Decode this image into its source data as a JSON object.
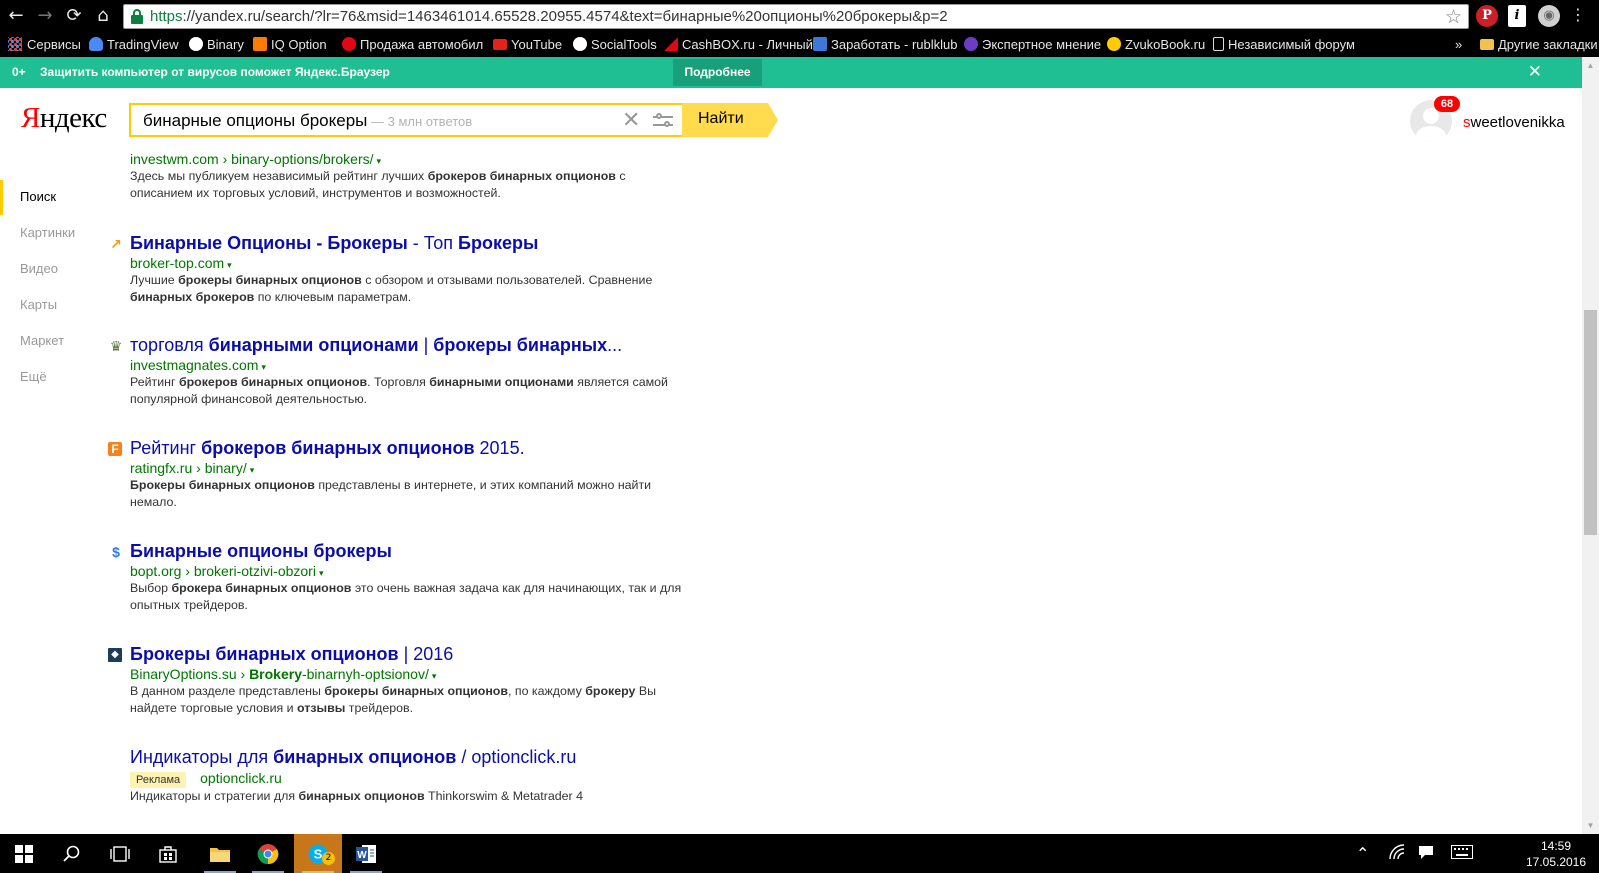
{
  "browser": {
    "url_scheme": "https",
    "url_rest": "://yandex.ru/search/?lr=76&msid=1463461014.65528.20955.4574&text=бинарные%20опционы%20брокеры&p=2",
    "nav": {
      "back": "←",
      "forward": "→",
      "reload": "⟳",
      "home": "⌂"
    },
    "bookmark_star": "☆",
    "extensions": {
      "pinterest": "P",
      "info": "i",
      "profile": "◉"
    }
  },
  "bookmarks": {
    "items": [
      {
        "label": "Сервисы",
        "icon": "apps-icon"
      },
      {
        "label": "TradingView",
        "icon": "cloud-icon",
        "color": "#4a8af4"
      },
      {
        "label": "Binary",
        "icon": "binary-icon",
        "color": "#ffffff"
      },
      {
        "label": "IQ Option",
        "icon": "iq-option-icon",
        "color": "#ff7a00"
      },
      {
        "label": "Продажа автомобил",
        "icon": "car-icon",
        "color": "#e30613"
      },
      {
        "label": "YouTube",
        "icon": "youtube-icon",
        "color": "#e62117"
      },
      {
        "label": "SocialTools",
        "icon": "socialtools-icon",
        "color": "#ffffff"
      },
      {
        "label": "CashBOX.ru - Личный",
        "icon": "cashbox-icon",
        "color": "#e30613"
      },
      {
        "label": "Заработать - rublklub",
        "icon": "rublklub-icon",
        "color": "#3b78d8"
      },
      {
        "label": "Экспертное мнение",
        "icon": "expert-icon",
        "color": "#6a3dc4"
      },
      {
        "label": "ZvukoBook.ru",
        "icon": "zvukobook-icon",
        "color": "#ffcc00"
      },
      {
        "label": "Независимый форум",
        "icon": "page-icon",
        "color": "#dddddd"
      }
    ],
    "overflow": "»",
    "other": "Другие закладки"
  },
  "promo": {
    "age": "0+",
    "message": "Защитить компьютер от вирусов поможет Яндекс.Браузер",
    "more": "Подробнее",
    "close": "✕"
  },
  "header": {
    "logo_first": "Я",
    "logo_rest": "ндекс",
    "query": "бинарные опционы брокеры",
    "result_count": " — 3 млн ответов",
    "clear": "✕",
    "find": "Найти",
    "badge": "68",
    "user_first": "s",
    "user_rest": "weetlovenikka"
  },
  "leftnav": {
    "items": [
      "Поиск",
      "Картинки",
      "Видео",
      "Карты",
      "Маркет",
      "Ещё"
    ],
    "active": "Поиск"
  },
  "results": {
    "partial": {
      "url": "investwm.com › binary-options/brokers/",
      "snippet_html": "Здесь мы публикуем независимый рейтинг лучших <b>брокеров бинарных опционов</b> с описанием их торговых условий, инструментов и возможностей."
    },
    "items": [
      {
        "title_html": "<b>Бинарные Опционы - Брокеры</b> - Топ <b>Брокеры</b>",
        "url": "broker-top.com",
        "snippet_html": "Лучшие <b>брокеры бинарных опционов</b> с обзором и отзывами пользователей. Сравнение <b>бинарных брокеров</b> по ключевым параметрам.",
        "favicon": "↗",
        "favicon_color": "#f39c12"
      },
      {
        "title_html": "торговля <b>бинарными опционами</b> | <b>брокеры бинарных</b>...",
        "url": "investmagnates.com",
        "snippet_html": "Рейтинг <b>брокеров бинарных опционов</b>. Торговля <b>бинарными опционами</b> является самой популярной финансовой деятельностью.",
        "favicon": "♛",
        "favicon_color": "#5a7a3a"
      },
      {
        "title_html": "Рейтинг <b>брокеров бинарных опционов</b> 2015.",
        "url": "ratingfx.ru › binary/",
        "snippet_html": "<b>Брокеры бинарных опционов</b> представлены в интернете, и этих компаний можно найти немало.",
        "favicon": "F",
        "favicon_color": "#f58220"
      },
      {
        "title_html": "<b>Бинарные опционы брокеры</b>",
        "url": "bopt.org › brokeri-otzivi-obzori",
        "snippet_html": "Выбор <b>брокера бинарных опционов</b> это очень важная задача как для начинающих, так и для опытных трейдеров.",
        "favicon": "$",
        "favicon_color": "#2c7be5"
      },
      {
        "title_html": "<b>Брокеры бинарных опционов</b> | 2016",
        "url_html": "BinaryOptions.su › <b>Brokery</b>-binarnyh-optsionov/",
        "url": "",
        "snippet_html": "В данном разделе представлены <b>брокеры бинарных опционов</b>, по каждому <b>брокеру</b> Вы найдете торговые условия и <b>отзывы</b> трейдеров.",
        "favicon": "◆",
        "favicon_color": "#1f3b5a"
      }
    ],
    "ad": {
      "title_html": "Индикаторы для <b>бинарных опционов</b> / optionclick.ru",
      "label": "Реклама",
      "url": "optionclick.ru",
      "snippet_html": "Индикаторы и стратегии для <b>бинарных опционов</b> Thinkorswim &amp; Metatrader 4"
    },
    "url_arrow": "▾"
  },
  "taskbar": {
    "time": "14:59",
    "date": "17.05.2016",
    "skype_count": "2"
  }
}
